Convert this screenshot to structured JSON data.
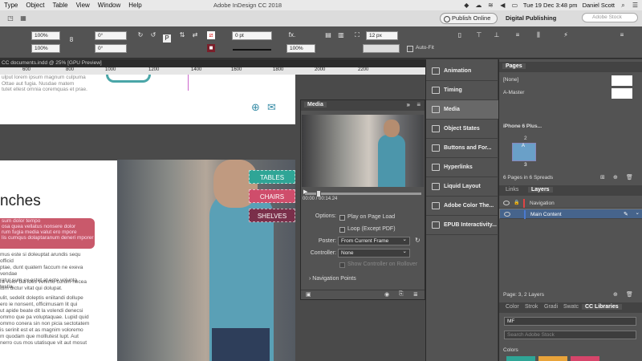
{
  "menubar": {
    "items": [
      "Type",
      "Object",
      "Table",
      "View",
      "Window",
      "Help"
    ],
    "app_title": "Adobe InDesign CC 2018",
    "datetime": "Tue 19 Dec  3:48 pm",
    "user": "Daniel Scott"
  },
  "header": {
    "publish_label": "Publish Online",
    "workspace": "Digital Publishing",
    "stock_search_placeholder": "Adobe Stock"
  },
  "controlbar": {
    "scale_x": "100%",
    "scale_y": "100%",
    "rotate": "0°",
    "shear": "0°",
    "stroke_weight": "0 pt",
    "opacity": "100%",
    "size_field": "12 px",
    "auto_fit": "Auto-Fit",
    "fx_label": "fx."
  },
  "document": {
    "tab_label": "CC documents.indd @ 25% [GPU Preview]",
    "ruler_ticks": [
      "600",
      "800",
      "1000",
      "1200",
      "1400",
      "1600",
      "1800",
      "2000",
      "2200"
    ]
  },
  "page1": {
    "lines": [
      "ulput lorem ipsum magnum culpuma",
      "Ottae aut fugia. Nusdae matem",
      "tutet ellest omnia coremquas et prae."
    ]
  },
  "page2": {
    "heading": "nches",
    "redbox_lines": [
      "sum dolor tempo",
      "osa quea vellatus nonsere dolor",
      "rum fugia media valut ero mpore",
      "lis cumqus dolaptaranum deneri mporer"
    ],
    "body1": [
      "mus este si doleuptat arundis sequ officid",
      "ptae, dunt quatem faccum ne exeva vendae",
      "ratur sum ex estet at ecte volupta testia."
    ],
    "body2": [
      "ra volor bia ibes venimo corum necea",
      "tum dictur vitat qui dolupat."
    ],
    "body3": [
      "ulit, sedelit doleptis eniitandi dollupe",
      "ero ie nonsent, officimusam lit qui",
      "ut apide beate dit la volendi denecsi",
      "ommo que pa voluptaquae. Lupid quid",
      "ommo conera sin non picia sectotatem",
      "is serinit est et as magnim voloremo",
      "m quodam que molllutest lupt. Aut",
      "nerro cus mos utatisque vit aut mosut"
    ]
  },
  "photo_tags": [
    "TABLES",
    "CHAIRS",
    "SHELVES"
  ],
  "panelstrip": {
    "items": [
      "Animation",
      "Timing",
      "Media",
      "Object States",
      "Buttons and For...",
      "Hyperlinks",
      "Liquid Layout",
      "Adobe Color The...",
      "EPUB Interactivity..."
    ]
  },
  "media_panel": {
    "title": "Media",
    "timecode": "00:00 / 00:14.24",
    "options_label": "Options:",
    "play_on_page_load": "Play on Page Load",
    "loop": "Loop (Except PDF)",
    "poster_label": "Poster:",
    "poster_value": "From Current Frame",
    "controller_label": "Controller:",
    "controller_value": "None",
    "show_controller": "Show Controller on Rollover",
    "nav_points": "Navigation Points"
  },
  "pages_panel": {
    "title": "Pages",
    "none_label": "[None]",
    "master_label": "A-Master",
    "device": "iPhone 6 Plus...",
    "page_number_2": "2",
    "page_number_3": "3",
    "master_badge": "A",
    "footer": "6 Pages in 6 Spreads"
  },
  "layers_panel": {
    "tabs": [
      "Links",
      "Layers"
    ],
    "rows": [
      "Navigation",
      "Main Content"
    ],
    "footer": "Page: 3, 2 Layers"
  },
  "libraries_panel": {
    "tabs": [
      "Color",
      "Strok",
      "Gradi",
      "Swatc",
      "CC Libraries"
    ],
    "library": "MF",
    "search_placeholder": "Search Adobe Stock",
    "colors_label": "Colors",
    "swatch_colors": [
      "#2fa596",
      "#e8a33a",
      "#d6456a"
    ]
  }
}
